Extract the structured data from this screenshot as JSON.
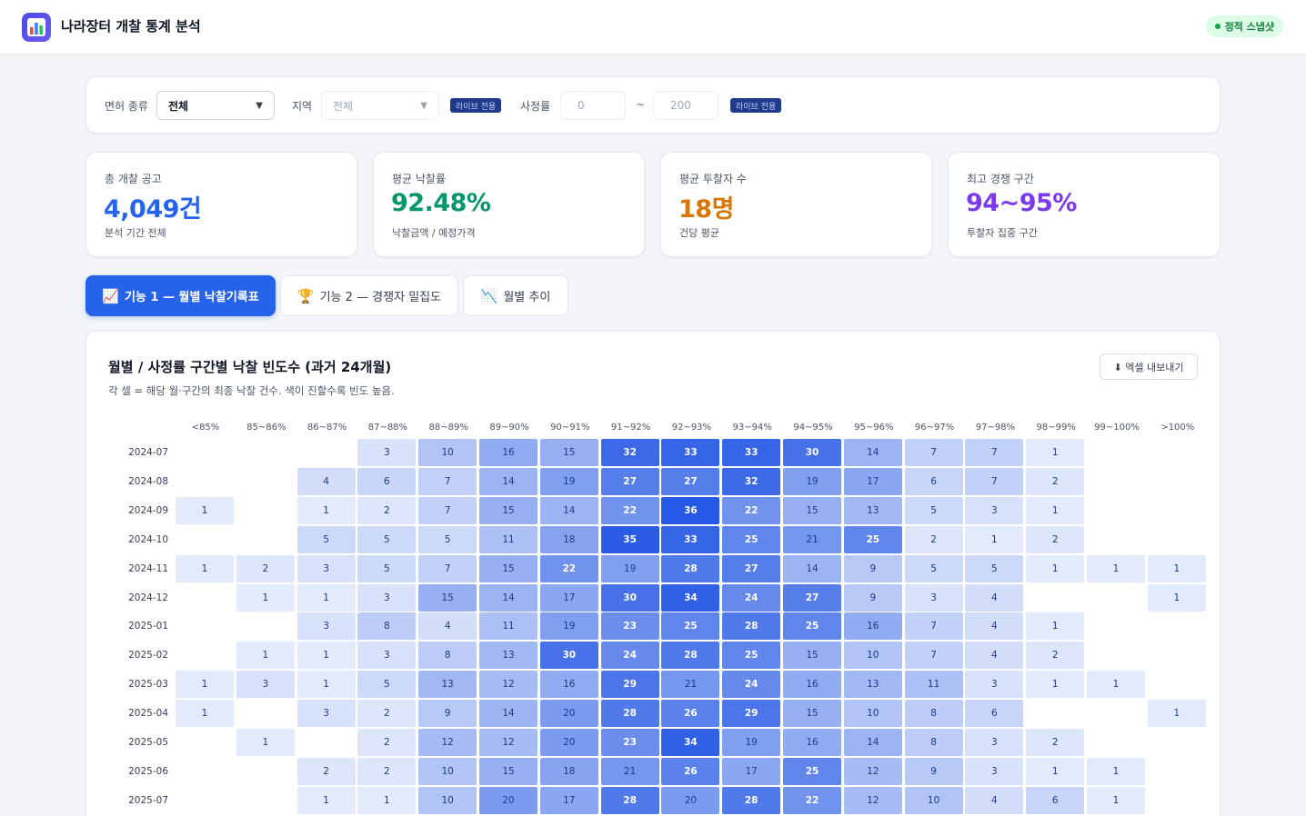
{
  "header": {
    "title": "나라장터 개찰 통계 분석",
    "badge": "정적 스냅샷"
  },
  "filters": {
    "license_label": "면허 종류",
    "license_value": "전체",
    "region_label": "지역",
    "region_value": "전체",
    "live_only": "라이브 전용",
    "rate_label": "사정률",
    "rate_min": "0",
    "rate_tilde": "~",
    "rate_max": "200"
  },
  "stats": [
    {
      "label": "총 개찰 공고",
      "value": "4,049건",
      "sub": "분석 기간 전체",
      "color": "#2563eb"
    },
    {
      "label": "평균 낙찰률",
      "value": "92.48%",
      "sub": "낙찰금액 / 예정가격",
      "color": "#059669"
    },
    {
      "label": "평균 투찰자 수",
      "value": "18명",
      "sub": "건당 평균",
      "color": "#d97706"
    },
    {
      "label": "최고 경쟁 구간",
      "value": "94~95%",
      "sub": "투찰자 집중 구간",
      "color": "#7c3aed"
    }
  ],
  "tabs": [
    {
      "icon": "📈",
      "label": "기능 1 — 월별 낙찰기록표",
      "active": true
    },
    {
      "icon": "🏆",
      "label": "기능 2 — 경쟁자 밀집도",
      "active": false
    },
    {
      "icon": "📉",
      "label": "월별 추이",
      "active": false
    }
  ],
  "heatmap": {
    "title": "월별 / 사정률 구간별 낙찰 빈도수 (과거 24개월)",
    "subtitle": "각 셀 = 해당 월·구간의 최종 낙찰 건수. 색이 진할수록 빈도 높음.",
    "export_label": "⬇ 엑셀 내보내기"
  },
  "chart_data": {
    "type": "heatmap",
    "title": "월별 / 사정률 구간별 낙찰 빈도수 (과거 24개월)",
    "columns": [
      "<85%",
      "85~86%",
      "86~87%",
      "87~88%",
      "88~89%",
      "89~90%",
      "90~91%",
      "91~92%",
      "92~93%",
      "93~94%",
      "94~95%",
      "95~96%",
      "96~97%",
      "97~98%",
      "98~99%",
      "99~100%",
      ">100%"
    ],
    "rows": [
      "2024-07",
      "2024-08",
      "2024-09",
      "2024-10",
      "2024-11",
      "2024-12",
      "2025-01",
      "2025-02",
      "2025-03",
      "2025-04",
      "2025-05",
      "2025-06",
      "2025-07"
    ],
    "values": [
      [
        null,
        null,
        null,
        3,
        10,
        16,
        15,
        32,
        33,
        33,
        30,
        14,
        7,
        7,
        1,
        null,
        null
      ],
      [
        null,
        null,
        4,
        6,
        7,
        14,
        19,
        27,
        27,
        32,
        19,
        17,
        6,
        7,
        2,
        null,
        null
      ],
      [
        1,
        null,
        1,
        2,
        7,
        15,
        14,
        22,
        36,
        22,
        15,
        13,
        5,
        3,
        1,
        null,
        null
      ],
      [
        null,
        null,
        5,
        5,
        5,
        11,
        18,
        35,
        33,
        25,
        21,
        25,
        2,
        1,
        2,
        null,
        null
      ],
      [
        1,
        2,
        3,
        5,
        7,
        15,
        22,
        19,
        28,
        27,
        14,
        9,
        5,
        5,
        1,
        1,
        1
      ],
      [
        null,
        1,
        1,
        3,
        15,
        14,
        17,
        30,
        34,
        24,
        27,
        9,
        3,
        4,
        null,
        null,
        1
      ],
      [
        null,
        null,
        3,
        8,
        4,
        11,
        19,
        23,
        25,
        28,
        25,
        16,
        7,
        4,
        1,
        null,
        null
      ],
      [
        null,
        1,
        1,
        3,
        8,
        13,
        30,
        24,
        28,
        25,
        15,
        10,
        7,
        4,
        2,
        null,
        null
      ],
      [
        1,
        3,
        1,
        5,
        13,
        12,
        16,
        29,
        21,
        24,
        16,
        13,
        11,
        3,
        1,
        1,
        null
      ],
      [
        1,
        null,
        3,
        2,
        9,
        14,
        20,
        28,
        26,
        29,
        15,
        10,
        8,
        6,
        null,
        null,
        1
      ],
      [
        null,
        1,
        null,
        2,
        12,
        12,
        20,
        23,
        34,
        19,
        16,
        14,
        8,
        3,
        2,
        null,
        null
      ],
      [
        null,
        null,
        2,
        2,
        10,
        15,
        18,
        21,
        26,
        17,
        25,
        12,
        9,
        3,
        1,
        1,
        null
      ],
      [
        null,
        null,
        1,
        1,
        10,
        20,
        17,
        28,
        20,
        28,
        22,
        12,
        10,
        4,
        6,
        1,
        null
      ]
    ]
  }
}
